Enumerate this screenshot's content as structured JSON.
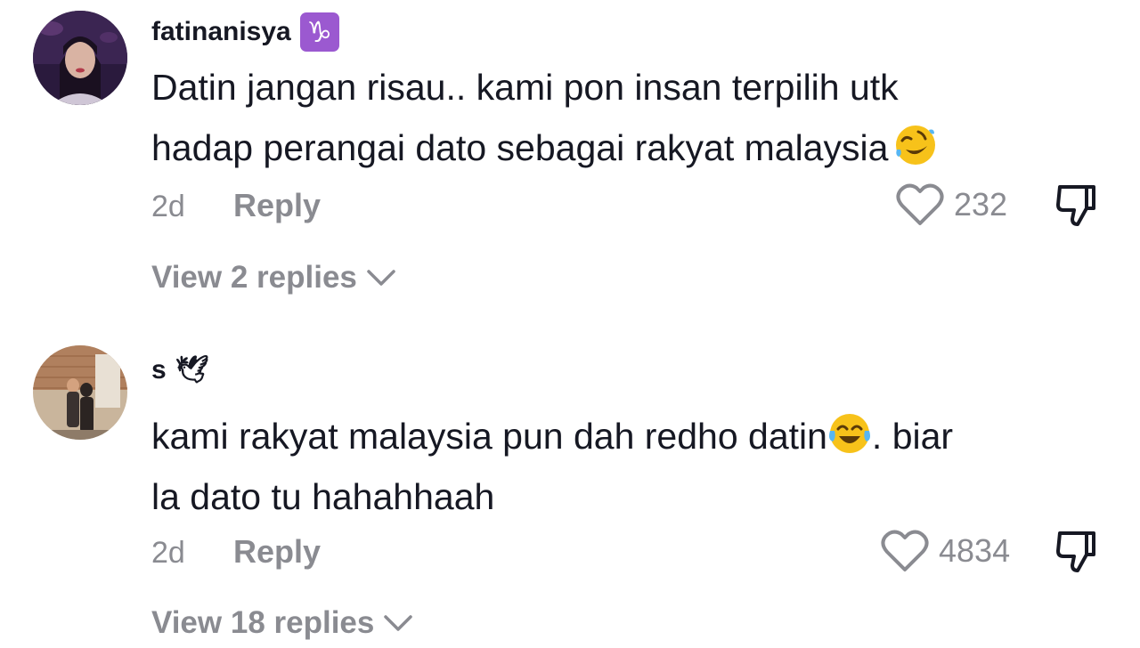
{
  "comments": [
    {
      "username": "fatinanisya",
      "zodiac_badge": "♑",
      "text": "Datin jangan risau.. kami pon insan terpilih utk\nhadap perangai dato sebagai rakyat malaysia",
      "emoji": "rolling-on-floor-laughing",
      "time": "2d",
      "reply_label": "Reply",
      "likes": "232",
      "view_replies": "View 2 replies"
    },
    {
      "username": "s",
      "username_emoji": "🕊",
      "text_before": "kami rakyat malaysia pun dah redho datin",
      "emoji": "face-with-tears-of-joy",
      "text_after": ". biar\nla dato tu hahahhaah",
      "time": "2d",
      "reply_label": "Reply",
      "likes": "4834",
      "view_replies": "View 18 replies"
    }
  ],
  "colors": {
    "text": "#161823",
    "muted": "#8a8b91",
    "zodiac_badge": "#9b59d0"
  },
  "icons": [
    "heart-outline-icon",
    "thumbs-down-icon",
    "chevron-down-icon"
  ]
}
